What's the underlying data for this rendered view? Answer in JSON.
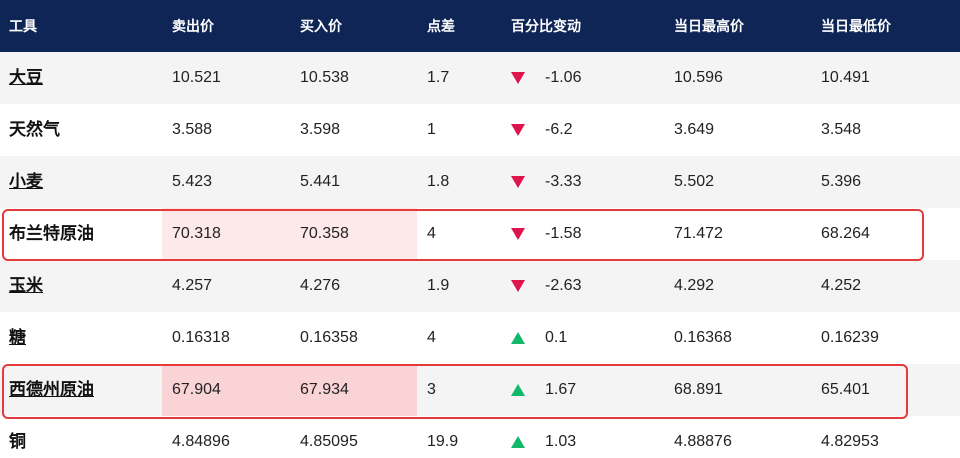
{
  "header": {
    "columns": [
      "工具",
      "卖出价",
      "买入价",
      "点差",
      "百分比变动",
      "当日最高价",
      "当日最低价"
    ]
  },
  "colors": {
    "header_bg": "#0e2556",
    "down": "#e0144c",
    "up": "#12b76a",
    "highlight_border": "#e53b3b"
  },
  "rows": [
    {
      "name": "大豆",
      "link": true,
      "sell": "10.521",
      "buy": "10.538",
      "spread": "1.7",
      "direction": "down",
      "change": "-1.06",
      "high": "10.596",
      "low": "10.491"
    },
    {
      "name": "天然气",
      "link": false,
      "sell": "3.588",
      "buy": "3.598",
      "spread": "1",
      "direction": "down",
      "change": "-6.2",
      "high": "3.649",
      "low": "3.548"
    },
    {
      "name": "小麦",
      "link": true,
      "sell": "5.423",
      "buy": "5.441",
      "spread": "1.8",
      "direction": "down",
      "change": "-3.33",
      "high": "5.502",
      "low": "5.396"
    },
    {
      "name": "布兰特原油",
      "link": false,
      "sell": "70.318",
      "buy": "70.358",
      "spread": "4",
      "direction": "down",
      "change": "-1.58",
      "high": "71.472",
      "low": "68.264"
    },
    {
      "name": "玉米",
      "link": true,
      "sell": "4.257",
      "buy": "4.276",
      "spread": "1.9",
      "direction": "down",
      "change": "-2.63",
      "high": "4.292",
      "low": "4.252"
    },
    {
      "name": "糖",
      "link": true,
      "sell": "0.16318",
      "buy": "0.16358",
      "spread": "4",
      "direction": "up",
      "change": "0.1",
      "high": "0.16368",
      "low": "0.16239"
    },
    {
      "name": "西德州原油",
      "link": true,
      "sell": "67.904",
      "buy": "67.934",
      "spread": "3",
      "direction": "up",
      "change": "1.67",
      "high": "68.891",
      "low": "65.401"
    },
    {
      "name": "铜",
      "link": false,
      "sell": "4.84896",
      "buy": "4.85095",
      "spread": "19.9",
      "direction": "up",
      "change": "1.03",
      "high": "4.88876",
      "low": "4.82953"
    }
  ]
}
